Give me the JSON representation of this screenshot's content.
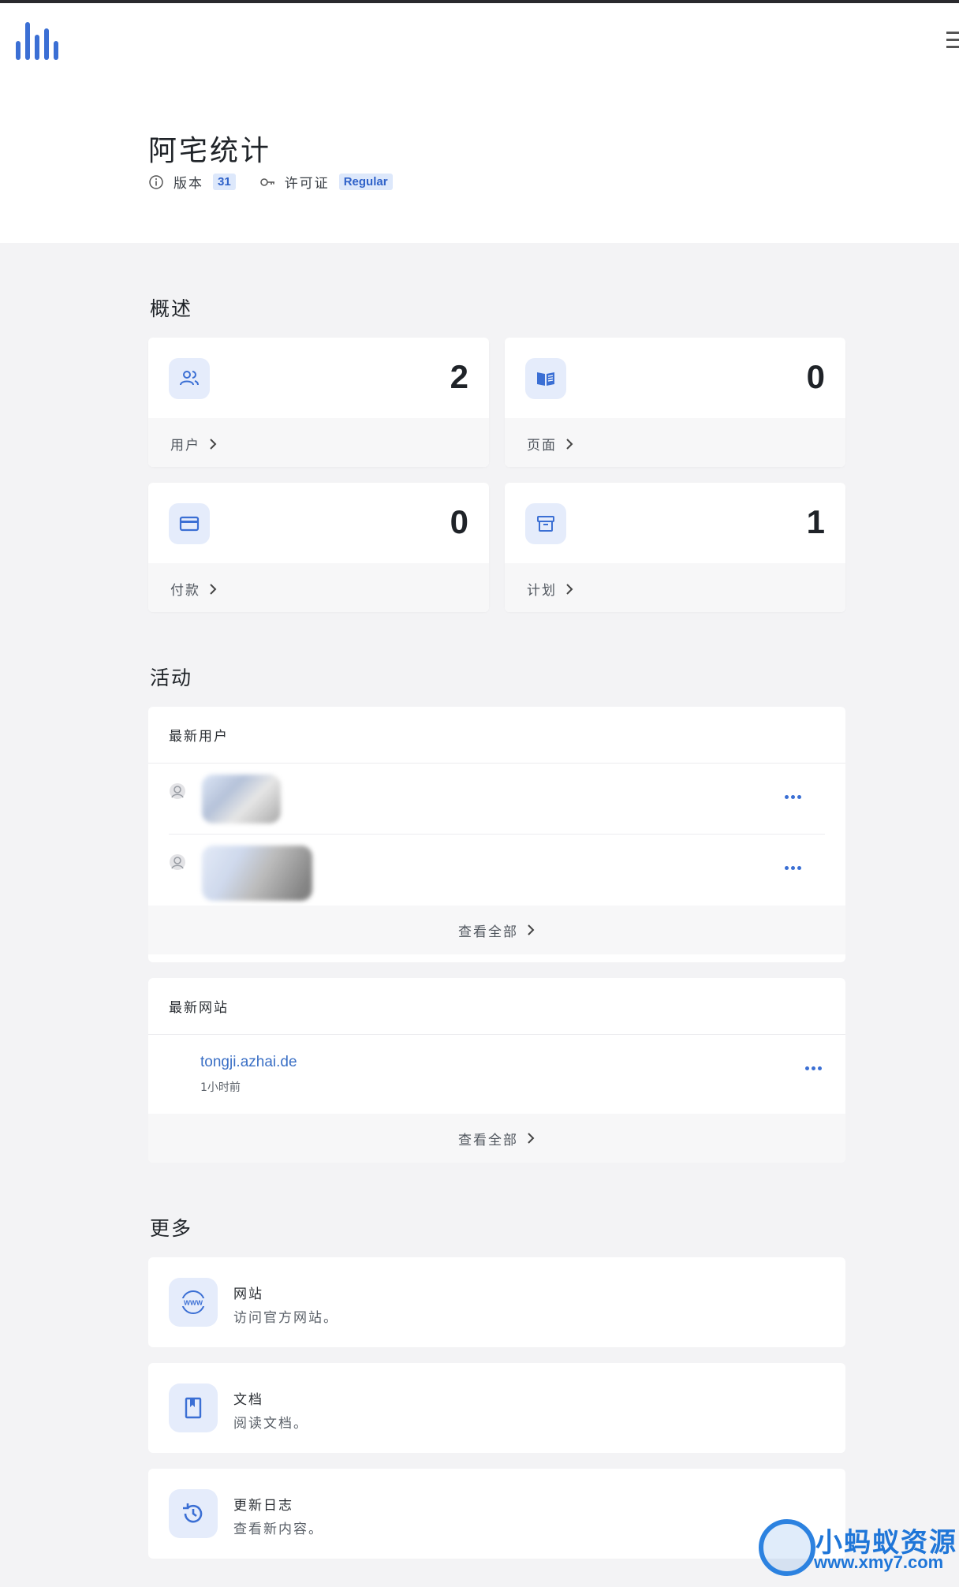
{
  "app": {
    "title": "阿宅统计",
    "version_label": "版本",
    "version_value": "31",
    "license_label": "许可证",
    "license_value": "Regular"
  },
  "overview": {
    "title": "概述",
    "stats": [
      {
        "label": "用户",
        "value": "2",
        "icon": "users-icon"
      },
      {
        "label": "页面",
        "value": "0",
        "icon": "book-open-icon"
      },
      {
        "label": "付款",
        "value": "0",
        "icon": "credit-card-icon"
      },
      {
        "label": "计划",
        "value": "1",
        "icon": "package-icon"
      }
    ]
  },
  "activity": {
    "title": "活动",
    "latest_users": {
      "title": "最新用户",
      "view_all": "查看全部"
    },
    "latest_sites": {
      "title": "最新网站",
      "items": [
        {
          "url": "tongji.azhai.de",
          "time": "1小时前"
        }
      ],
      "view_all": "查看全部"
    }
  },
  "more": {
    "title": "更多",
    "items": [
      {
        "title": "网站",
        "desc": "访问官方网站。",
        "icon": "www-globe-icon"
      },
      {
        "title": "文档",
        "desc": "阅读文档。",
        "icon": "bookmark-book-icon"
      },
      {
        "title": "更新日志",
        "desc": "查看新内容。",
        "icon": "history-icon"
      }
    ]
  },
  "watermark": {
    "text": "小蚂蚁资源网",
    "url": "www.xmy7.com"
  },
  "colors": {
    "accent": "#3b6fd4",
    "icon_bg": "#e5ecfb",
    "page_bg": "#f3f3f5"
  }
}
